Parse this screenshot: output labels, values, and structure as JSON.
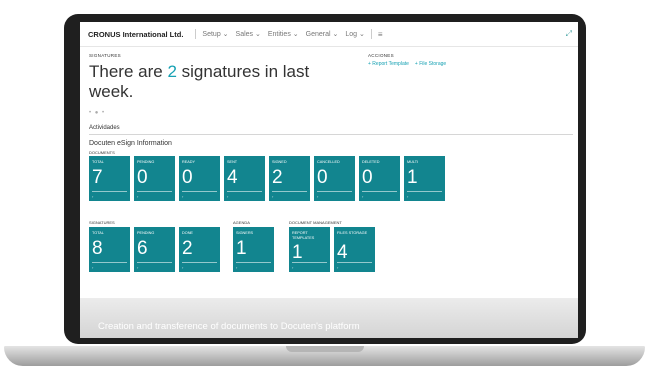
{
  "topbar": {
    "company": "CRONUS International Ltd.",
    "menu": [
      "Setup ⌄",
      "Sales ⌄",
      "Entities ⌄",
      "General ⌄",
      "Log ⌄"
    ],
    "hamburger": "≡",
    "expand": "⤢"
  },
  "header": {
    "section_label": "SIGNATURES",
    "headline_pre": "There are ",
    "headline_num": "2",
    "headline_post": " signatures in last week.",
    "actions_label": "ACCIONES",
    "actions": [
      "+ Report Template",
      "+ File Storage"
    ],
    "dots": "• ● •"
  },
  "activities": {
    "title": "Actividades",
    "group_title": "Docuten eSign Information",
    "group_sub": "DOCUMENTS",
    "documents": [
      {
        "label": "TOTAL",
        "value": "7"
      },
      {
        "label": "PENDING",
        "value": "0"
      },
      {
        "label": "READY",
        "value": "0"
      },
      {
        "label": "SENT",
        "value": "4"
      },
      {
        "label": "SIGNED",
        "value": "2"
      },
      {
        "label": "CANCELLED",
        "value": "0"
      },
      {
        "label": "DELETED",
        "value": "0"
      },
      {
        "label": "MULTI",
        "value": "1"
      }
    ],
    "signatures_label": "SIGNATURES",
    "signatures": [
      {
        "label": "TOTAL",
        "value": "8"
      },
      {
        "label": "PENDING",
        "value": "6"
      },
      {
        "label": "DONE",
        "value": "2"
      }
    ],
    "agenda_label": "AGENDA",
    "agenda": [
      {
        "label": "SIGNERS",
        "value": "1"
      }
    ],
    "docmgmt_label": "DOCUMENT MANAGEMENT",
    "docmgmt": [
      {
        "label": "REPORT TEMPLATES",
        "value": "1"
      },
      {
        "label": "FILES STORAGE",
        "value": "4"
      }
    ],
    "tile_arrow": "›"
  },
  "footer": {
    "text": "Creation and transference of documents to Docuten's platform"
  },
  "colors": {
    "tile": "#12858f",
    "accent": "#16a1b3"
  }
}
